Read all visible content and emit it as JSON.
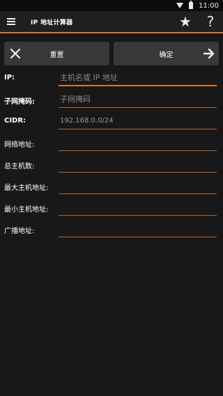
{
  "status_bar": {
    "time": "11:00"
  },
  "app_bar": {
    "title": "IP 地址计算器"
  },
  "buttons": {
    "reset_label": "重置",
    "confirm_label": "确定"
  },
  "form": {
    "rows": [
      {
        "label": "IP:",
        "placeholder": "主机名或 IP 地址",
        "value": ""
      },
      {
        "label": "子网掩码:",
        "placeholder": "子网掩码",
        "value": ""
      },
      {
        "label": "CIDR:",
        "placeholder": "",
        "value": "192.168.0.0/24"
      },
      {
        "label": "网络地址:",
        "value": ""
      },
      {
        "label": "总主机数:",
        "value": ""
      },
      {
        "label": "最大主机地址:",
        "value": ""
      },
      {
        "label": "最小主机地址:",
        "value": ""
      },
      {
        "label": "广播地址:",
        "value": ""
      }
    ]
  },
  "colors": {
    "accent": "#e8711f",
    "background": "#181818",
    "button_bg": "#383838"
  },
  "icons": [
    "wifi-icon",
    "battery-icon",
    "menu-icon",
    "star-icon",
    "help-icon",
    "close-icon",
    "arrow-right-icon"
  ]
}
